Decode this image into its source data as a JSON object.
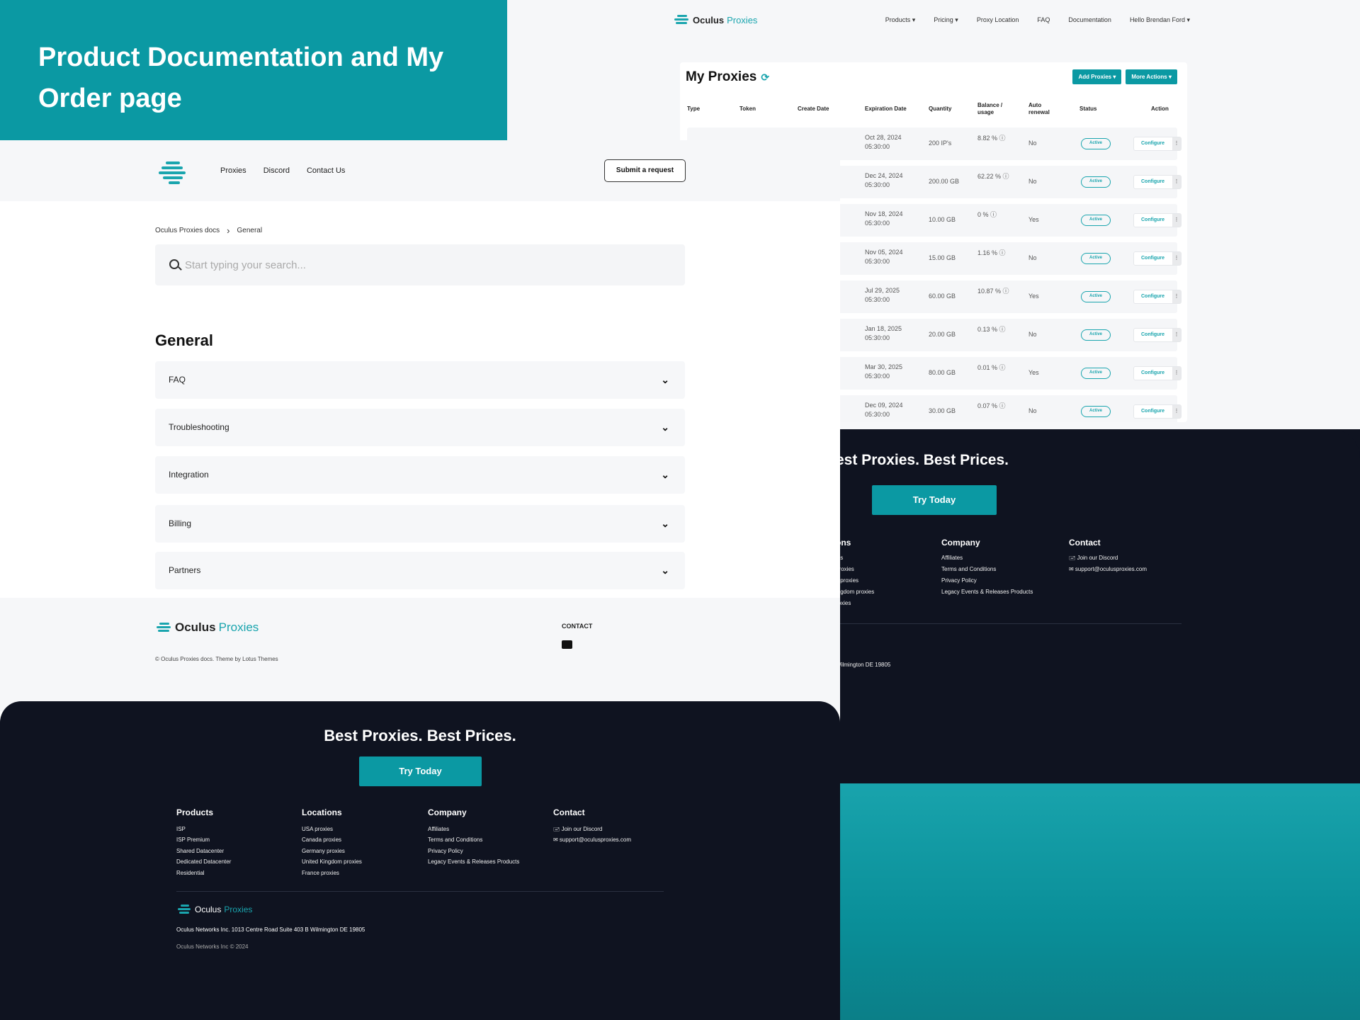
{
  "hero": {
    "title": "Product Documentation and My Order page"
  },
  "top_nav": {
    "brand": "Oculus",
    "brand_accent": "Proxies",
    "links": [
      "Products ▾",
      "Pricing ▾",
      "Proxy Location",
      "FAQ",
      "Documentation",
      "Hello Brendan Ford ▾"
    ]
  },
  "my_proxies": {
    "title": "My Proxies",
    "add_button": "Add Proxies ▾",
    "more_button": "More Actions ▾",
    "columns": [
      "Type",
      "Token",
      "Create Date",
      "Expiration Date",
      "Quantity",
      "Balance / usage",
      "Auto renewal",
      "Status",
      "Action"
    ],
    "rows": [
      {
        "exp": "Oct 28, 2024 05:30:00",
        "qty": "200 IP's",
        "bal": "8.82 % ⓘ",
        "auto": "No",
        "status": "Active",
        "action": "Configure"
      },
      {
        "exp": "Dec 24, 2024 05:30:00",
        "qty": "200.00 GB",
        "bal": "62.22 % ⓘ",
        "auto": "No",
        "status": "Active",
        "action": "Configure"
      },
      {
        "exp": "Nov 18, 2024 05:30:00",
        "qty": "10.00 GB",
        "bal": "0 % ⓘ",
        "auto": "Yes",
        "status": "Active",
        "action": "Configure"
      },
      {
        "exp": "Nov 05, 2024 05:30:00",
        "qty": "15.00 GB",
        "bal": "1.16 % ⓘ",
        "auto": "No",
        "status": "Active",
        "action": "Configure"
      },
      {
        "exp": "Jul 29, 2025 05:30:00",
        "qty": "60.00 GB",
        "bal": "10.87 % ⓘ",
        "auto": "Yes",
        "status": "Active",
        "action": "Configure"
      },
      {
        "exp": "Jan 18, 2025 05:30:00",
        "qty": "20.00 GB",
        "bal": "0.13 % ⓘ",
        "auto": "No",
        "status": "Active",
        "action": "Configure"
      },
      {
        "exp": "Mar 30, 2025 05:30:00",
        "qty": "80.00 GB",
        "bal": "0.01 % ⓘ",
        "auto": "Yes",
        "status": "Active",
        "action": "Configure"
      },
      {
        "exp": "Dec 09, 2024 05:30:00",
        "qty": "30.00 GB",
        "bal": "0.07 % ⓘ",
        "auto": "No",
        "status": "Active",
        "action": "Configure"
      }
    ]
  },
  "right_footer": {
    "tagline": "est Proxies. Best Prices.",
    "cta": "Try Today",
    "locations_partial": {
      "heading": "ons",
      "items": [
        "ies",
        "proxies",
        "y proxies",
        "ingdom proxies",
        "roxies"
      ]
    },
    "company": {
      "heading": "Company",
      "items": [
        "Affiliates",
        "Terms and Conditions",
        "Privacy Policy",
        "Legacy Events & Releases Products"
      ]
    },
    "contact": {
      "heading": "Contact",
      "items": [
        "🖃 Join our Discord",
        "✉ support@oculusproxies.com"
      ]
    },
    "address_partial": "Wilmington DE 19805"
  },
  "doc_header": {
    "nav": [
      "Proxies",
      "Discord",
      "Contact Us"
    ],
    "submit": "Submit a request"
  },
  "breadcrumb": {
    "root": "Oculus Proxies docs",
    "sep": "›",
    "current": "General"
  },
  "search": {
    "placeholder": "Start typing your search..."
  },
  "section": {
    "title": "General",
    "items": [
      "FAQ",
      "Troubleshooting",
      "Integration",
      "Billing",
      "Partners"
    ]
  },
  "doc_footer": {
    "brand": "Oculus",
    "brand_accent": "Proxies",
    "copyright": "© Oculus Proxies docs. Theme by Lotus Themes",
    "contact_label": "CONTACT"
  },
  "dark_footer": {
    "tagline": "Best Proxies. Best Prices.",
    "cta": "Try Today",
    "products": {
      "heading": "Products",
      "items": [
        "ISP",
        "ISP Premium",
        "Shared Datacenter",
        "Dedicated Datacenter",
        "Residential"
      ]
    },
    "locations": {
      "heading": "Locations",
      "items": [
        "USA proxies",
        "Canada proxies",
        "Germany proxies",
        "United Kingdom proxies",
        "France proxies"
      ]
    },
    "company": {
      "heading": "Company",
      "items": [
        "Affiliates",
        "Terms and Conditions",
        "Privacy Policy",
        "Legacy Events & Releases Products"
      ]
    },
    "contact": {
      "heading": "Contact",
      "items": [
        "🖃 Join our Discord",
        "✉ support@oculusproxies.com"
      ]
    },
    "brand": "Oculus",
    "brand_accent": "Proxies",
    "address": "Oculus Networks Inc. 1013 Centre Road Suite 403 B Wilmington DE 19805",
    "copyright": "Oculus Networks Inc © 2024"
  },
  "colors": {
    "accent": "#0b99a3",
    "dark": "#0f1320",
    "light": "#f6f7f9"
  }
}
